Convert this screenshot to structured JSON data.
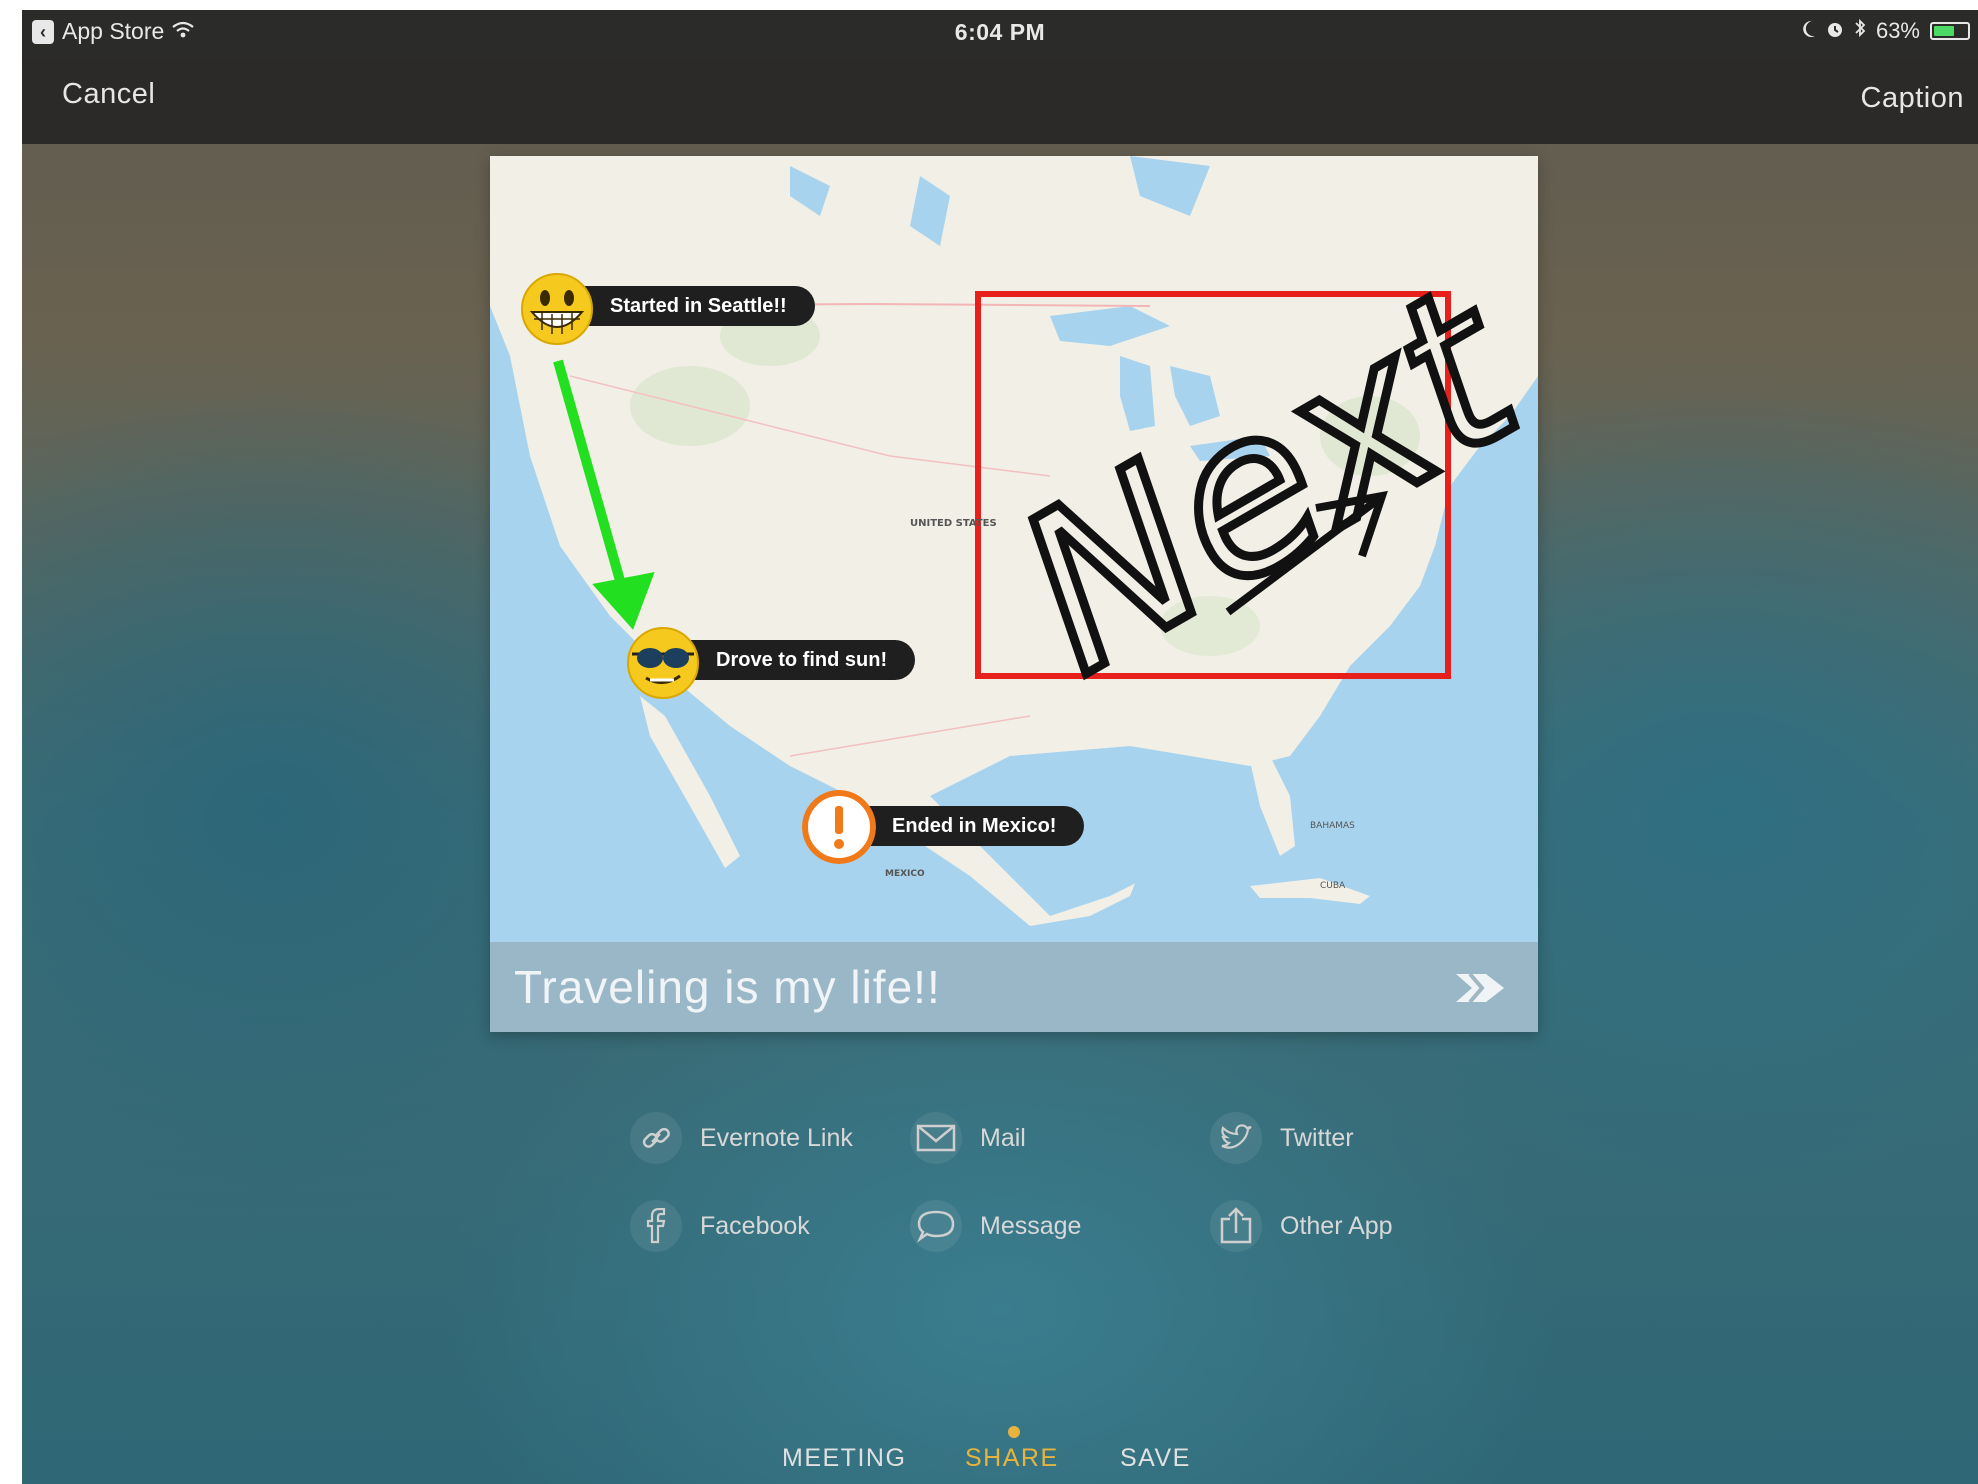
{
  "status_bar": {
    "back_app": "App Store",
    "time": "6:04 PM",
    "battery_percent": "63%",
    "battery_level": 0.63
  },
  "nav": {
    "cancel_label": "Cancel",
    "caption_label": "Caption"
  },
  "map": {
    "callouts": [
      {
        "text": "Started in Seattle!!",
        "emoji": "grinning-face-icon"
      },
      {
        "text": "Drove to find sun!",
        "emoji": "sunglasses-face-icon"
      },
      {
        "text": "Ended in Mexico!",
        "emoji": "exclamation-marker-icon"
      }
    ],
    "annotation_text": "Next",
    "annotation_box_color": "#e8201c",
    "arrow_color": "#22e01f",
    "labels": [
      "UNITED STATES",
      "MEXICO",
      "BAHAMAS",
      "CUBA"
    ]
  },
  "caption": {
    "text": "Traveling is my life!!"
  },
  "share": {
    "items": [
      {
        "label": "Evernote Link",
        "icon": "link-icon"
      },
      {
        "label": "Mail",
        "icon": "mail-icon"
      },
      {
        "label": "Twitter",
        "icon": "twitter-icon"
      },
      {
        "label": "Facebook",
        "icon": "facebook-icon"
      },
      {
        "label": "Message",
        "icon": "message-icon"
      },
      {
        "label": "Other App",
        "icon": "share-out-icon"
      }
    ]
  },
  "tabs": [
    {
      "label": "MEETING",
      "active": false
    },
    {
      "label": "SHARE",
      "active": true
    },
    {
      "label": "SAVE",
      "active": false
    }
  ],
  "colors": {
    "accent": "#e6b43c"
  }
}
